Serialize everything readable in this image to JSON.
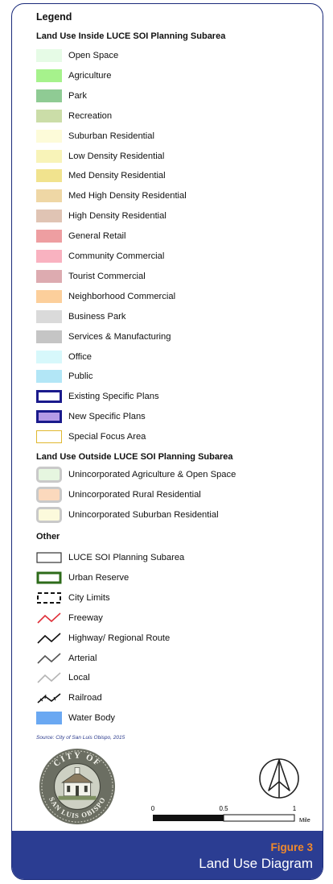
{
  "legend": {
    "title": "Legend",
    "inside_heading": "Land Use Inside LUCE SOI Planning Subarea",
    "outside_heading": "Land Use Outside LUCE SOI Planning Subarea",
    "other_heading": "Other",
    "inside": [
      {
        "label": "Open Space",
        "color": "#e6fbe6"
      },
      {
        "label": "Agriculture",
        "color": "#a6f28c"
      },
      {
        "label": "Park",
        "color": "#8fcb94"
      },
      {
        "label": "Recreation",
        "color": "#cbdda8"
      },
      {
        "label": "Suburban Residential",
        "color": "#fdfbd9"
      },
      {
        "label": "Low Density Residential",
        "color": "#f8f3b8"
      },
      {
        "label": "Med Density Residential",
        "color": "#f1e38e"
      },
      {
        "label": "Med High Density Residential",
        "color": "#efd7a5"
      },
      {
        "label": "High Density Residential",
        "color": "#e0c4b4"
      },
      {
        "label": "General Retail",
        "color": "#ee9ea1"
      },
      {
        "label": "Community Commercial",
        "color": "#f9b2c0"
      },
      {
        "label": "Tourist Commercial",
        "color": "#ddabb0"
      },
      {
        "label": "Neighborhood Commercial",
        "color": "#fccf9b"
      },
      {
        "label": "Business Park",
        "color": "#dadada"
      },
      {
        "label": "Services & Manufacturing",
        "color": "#c5c5c5"
      },
      {
        "label": "Office",
        "color": "#d7f8fb"
      },
      {
        "label": "Public",
        "color": "#b2e6f6"
      },
      {
        "label": "Existing Specific Plans",
        "color": "#ffffff",
        "border": "#1a1a8c"
      },
      {
        "label": "New Specific Plans",
        "color": "#b49ae6",
        "border": "#1a1a8c"
      },
      {
        "label": "Special Focus Area",
        "color": "#ffffff",
        "border": "#e0b830"
      }
    ],
    "outside": [
      {
        "label": "Unincorporated Agriculture & Open Space",
        "color": "#e6f6e0",
        "border": "#c9c9c9"
      },
      {
        "label": "Unincorporated Rural Residential",
        "color": "#fbd9bd",
        "border": "#c9c9c9"
      },
      {
        "label": "Unincorporated Suburban Residential",
        "color": "#fcfadc",
        "border": "#c9c9c9"
      }
    ],
    "other": [
      {
        "label": "LUCE SOI Planning Subarea",
        "icon": "outline-rect-icon"
      },
      {
        "label": "Urban Reserve",
        "icon": "green-rect-icon"
      },
      {
        "label": "City Limits",
        "icon": "dashed-rect-icon"
      },
      {
        "label": "Freeway",
        "icon": "red-line-icon",
        "color": "#e0303a"
      },
      {
        "label": "Highway/ Regional Route",
        "icon": "black-line-icon",
        "color": "#111111"
      },
      {
        "label": "Arterial",
        "icon": "gray-line-icon",
        "color": "#555555"
      },
      {
        "label": "Local",
        "icon": "lightgray-line-icon",
        "color": "#b5b5b5"
      },
      {
        "label": "Railroad",
        "icon": "railroad-icon",
        "color": "#111111"
      },
      {
        "label": "Water Body",
        "icon": "water-swatch",
        "color": "#6aa8f2"
      }
    ]
  },
  "source": "Source: City of San Luis Obispo, 2015",
  "seal": {
    "top_text": "CITY OF",
    "bottom_text": "SAN LUIS OBISPO"
  },
  "scale": {
    "ticks": [
      "0",
      "0.5",
      "1"
    ],
    "unit": "Mile"
  },
  "figure": {
    "number": "Figure 3",
    "title": "Land Use Diagram"
  }
}
